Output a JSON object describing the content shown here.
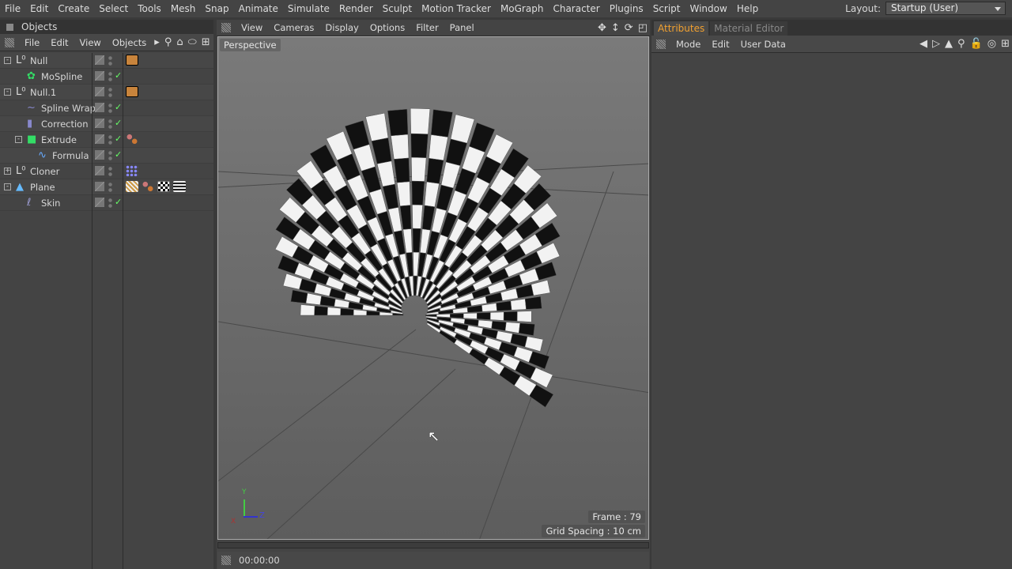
{
  "menubar": {
    "items": [
      "File",
      "Edit",
      "Create",
      "Select",
      "Tools",
      "Mesh",
      "Snap",
      "Animate",
      "Simulate",
      "Render",
      "Sculpt",
      "Motion Tracker",
      "MoGraph",
      "Character",
      "Plugins",
      "Script",
      "Window",
      "Help"
    ],
    "layout_label": "Layout:",
    "layout_value": "Startup (User)"
  },
  "objects": {
    "title": "Objects",
    "menu": [
      "File",
      "Edit",
      "View",
      "Objects"
    ],
    "items": [
      {
        "name": "Null",
        "depth": 0,
        "expand": "-",
        "icon": "null-icon",
        "tags": [
          "display-tag"
        ]
      },
      {
        "name": "MoSpline",
        "depth": 1,
        "icon": "mospline-icon",
        "check": true,
        "tags": []
      },
      {
        "name": "Null.1",
        "depth": 0,
        "expand": "-",
        "icon": "null-icon",
        "tags": [
          "display-tag"
        ]
      },
      {
        "name": "Spline Wrap",
        "depth": 1,
        "icon": "spline-wrap-icon",
        "check": true,
        "tags": []
      },
      {
        "name": "Correction",
        "depth": 1,
        "icon": "correction-icon",
        "check": true,
        "tags": []
      },
      {
        "name": "Extrude",
        "depth": 1,
        "expand": "-",
        "icon": "extrude-icon",
        "check": true,
        "tags": [
          "phong-tag"
        ]
      },
      {
        "name": "Formula",
        "depth": 2,
        "icon": "formula-icon",
        "check": true,
        "tags": []
      },
      {
        "name": "Cloner",
        "depth": 0,
        "expand": "+",
        "icon": "null-icon",
        "tags": [
          "mograph-selection-tag"
        ]
      },
      {
        "name": "Plane",
        "depth": 0,
        "expand": "-",
        "icon": "plane-icon",
        "tags": [
          "uvw-tag",
          "phong-tag",
          "checker-material-tag",
          "stripe-material-tag"
        ]
      },
      {
        "name": "Skin",
        "depth": 1,
        "icon": "skin-icon",
        "check": true,
        "tags": []
      }
    ]
  },
  "viewport": {
    "menu": [
      "View",
      "Cameras",
      "Display",
      "Options",
      "Filter",
      "Panel"
    ],
    "camera_label": "Perspective",
    "frame": "Frame : 79",
    "grid_spacing": "Grid Spacing : 10 cm",
    "axis": {
      "y": "Y",
      "z": "Z",
      "x": "X"
    }
  },
  "timeline": {
    "time": "00:00:00"
  },
  "attributes": {
    "tabs": [
      "Attributes",
      "Material Editor"
    ],
    "active_tab": "Attributes",
    "menu": [
      "Mode",
      "Edit",
      "User Data"
    ]
  },
  "colors": {
    "accent": "#f0a030",
    "check": "#66ff66"
  }
}
